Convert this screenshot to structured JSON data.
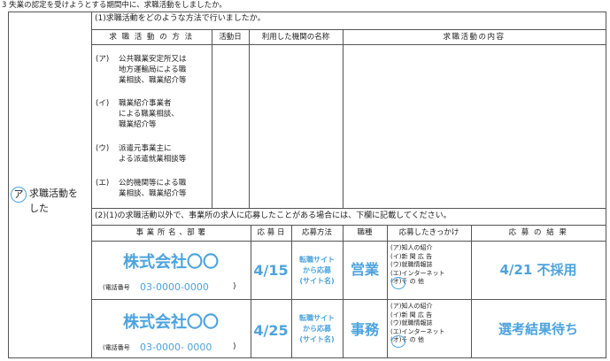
{
  "header": {
    "title": "3 失業の認定を受けようとする期間中に、求職活動をしましたか。"
  },
  "left": {
    "circle": "ア",
    "label_line1": "求職活動を",
    "label_line2": "した"
  },
  "section1": {
    "question": "(1)求職活動をどのような方法で行いましたか。",
    "columns": [
      "求 職 活 動 の 方 法",
      "活動日",
      "利用した機関の名称",
      "求職活動の内容"
    ],
    "methods": [
      {
        "mark": "(ア)",
        "lines": [
          "公共職業安定所又は",
          "地方運輸局による職",
          "業相談、職業紹介等"
        ]
      },
      {
        "mark": "(イ)",
        "lines": [
          "職業紹介事業者",
          "による職業相談、",
          "職業紹介等"
        ]
      },
      {
        "mark": "(ウ)",
        "lines": [
          "派遣元事業主に",
          "よる派遣就業相談等"
        ]
      },
      {
        "mark": "(エ)",
        "lines": [
          "公的機関等による職",
          "業相談、職業紹介等"
        ]
      }
    ]
  },
  "section2": {
    "question": "(2)(1)の求職活動以外で、事業所の求人に応募したことがある場合には、下欄に記載してください。",
    "columns": [
      "事 業 所 名 、部 署",
      "応 募 日",
      "応募方法",
      "職種",
      "応募したきっかけ",
      "応 募 の 結 果"
    ],
    "options": [
      "(ア)知人の紹介",
      "(イ)新 聞 広 告",
      "(ウ)就職情報誌",
      "(エ)インターネット",
      "(オ)そ  の  他"
    ],
    "rows": [
      {
        "company": "株式会社〇〇",
        "phone_label": "(電話番号",
        "phone": "03-0000-0000",
        "phone_close": ")",
        "date": "4/15",
        "method_lines": [
          "転職サイト",
          "から応募",
          "(サイト名)"
        ],
        "job": "営業",
        "result": "4/21 不採用"
      },
      {
        "company": "株式会社〇〇",
        "phone_label": "(電話番号",
        "phone": "03-0000- 0000",
        "phone_close": ")",
        "date": "4/25",
        "method_lines": [
          "転職サイト",
          "から応募",
          "(サイト名)"
        ],
        "job": "事務",
        "result": "選考結果待ち"
      }
    ]
  }
}
